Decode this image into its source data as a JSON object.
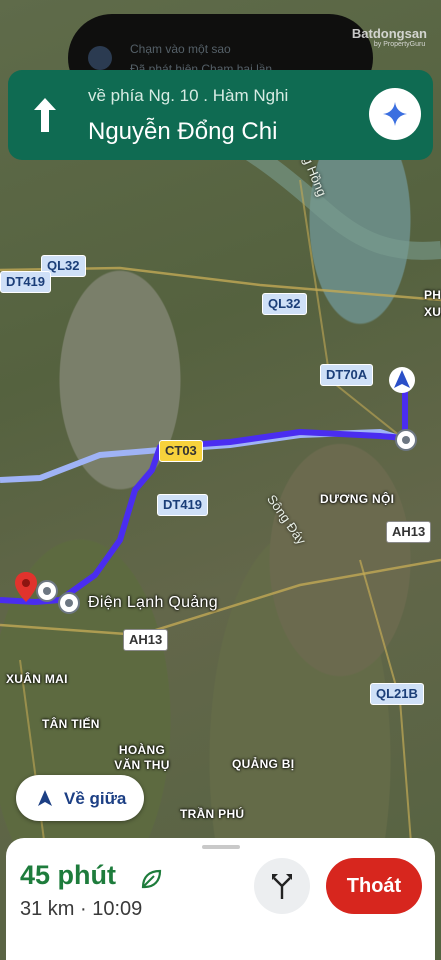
{
  "status_bar": {
    "line1": "Chạm vào một sao",
    "line2": "Đã phát hiện Chạm hai lần"
  },
  "watermark": {
    "brand": "Batdongsan",
    "tagline": "by PropertyGuru"
  },
  "nav_banner": {
    "toward": "về phía Ng. 10 . Hàm Nghi",
    "street": "Nguyễn Đổng Chi",
    "color": "#0f6b52"
  },
  "map": {
    "roads": {
      "ql32_a": "QL32",
      "ql32_b": "QL32",
      "dt419_a": "DT419",
      "dt419_b": "DT419",
      "dt70a": "DT70A",
      "ct03": "CT03",
      "ah13_a": "AH13",
      "ah13_b": "AH13",
      "ql21b": "QL21B"
    },
    "places": {
      "duong_noi": "DƯƠNG NỘI",
      "xuan_mai": "XUÂN MAI",
      "tan_tien": "TÂN TIẾN",
      "hoang_van_thu": "HOÀNG VĂN THỤ",
      "quang_bi": "QUẢNG BỊ",
      "tran_phu": "TRẦN PHÚ",
      "dien_lanh": "Điện Lạnh Quảng",
      "right_edge_1": "PH",
      "right_edge_2": "XUÂ"
    },
    "rivers": {
      "song_hong": "Sông Hồng",
      "song_day": "Sông Đáy"
    },
    "route_color": "#4a2df0"
  },
  "recenter": {
    "label": "Về giữa"
  },
  "bottom_sheet": {
    "duration": "45 phút",
    "distance_eta": "31 km · 10:09",
    "exit_label": "Thoát",
    "duration_color": "#1e7c3c",
    "exit_color": "#d7261e"
  }
}
